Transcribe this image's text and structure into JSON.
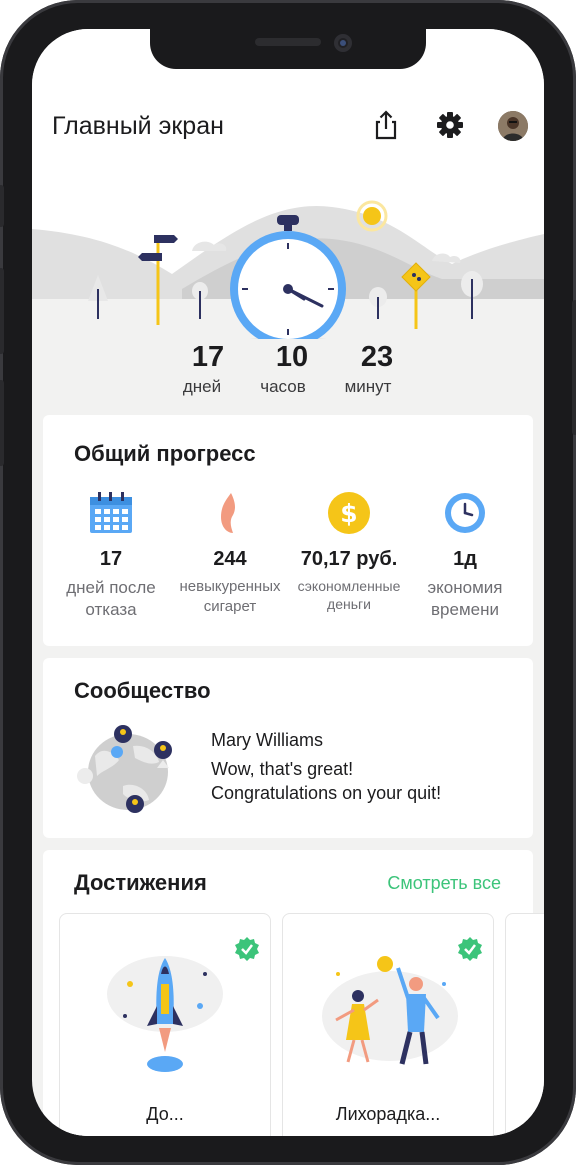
{
  "header": {
    "title": "Главный экран",
    "share_icon": "share-icon",
    "settings_icon": "gear-icon",
    "avatar": "user-avatar"
  },
  "timer": {
    "days": {
      "value": "17",
      "label": "дней"
    },
    "hours": {
      "value": "10",
      "label": "часов"
    },
    "minutes": {
      "value": "23",
      "label": "минут"
    }
  },
  "progress": {
    "title": "Общий прогресс",
    "items": [
      {
        "icon": "calendar-icon",
        "value": "17",
        "label1": "дней после",
        "label2": "отказа"
      },
      {
        "icon": "flame-icon",
        "value": "244",
        "label1": "невыкуренных",
        "label2": "сигарет"
      },
      {
        "icon": "dollar-coin-icon",
        "value": "70,17 руб.",
        "label1": "сэкономленные",
        "label2": "деньги"
      },
      {
        "icon": "clock-icon",
        "value": "1д",
        "label1": "экономия",
        "label2": "времени"
      }
    ]
  },
  "community": {
    "title": "Сообщество",
    "author": "Mary Williams",
    "message_line1": "Wow, that's great!",
    "message_line2": "Congratulations on your quit!"
  },
  "achievements": {
    "title": "Достижения",
    "see_all": "Смотреть все",
    "items": [
      {
        "label": "До...",
        "icon": "rocket-icon",
        "done": true
      },
      {
        "label": "Лихорадка...",
        "icon": "dancing-people-icon",
        "done": true
      }
    ]
  },
  "colors": {
    "accent_green": "#3cc47a",
    "timer_blue": "#5aa8f5",
    "coin_yellow": "#f5c518"
  }
}
